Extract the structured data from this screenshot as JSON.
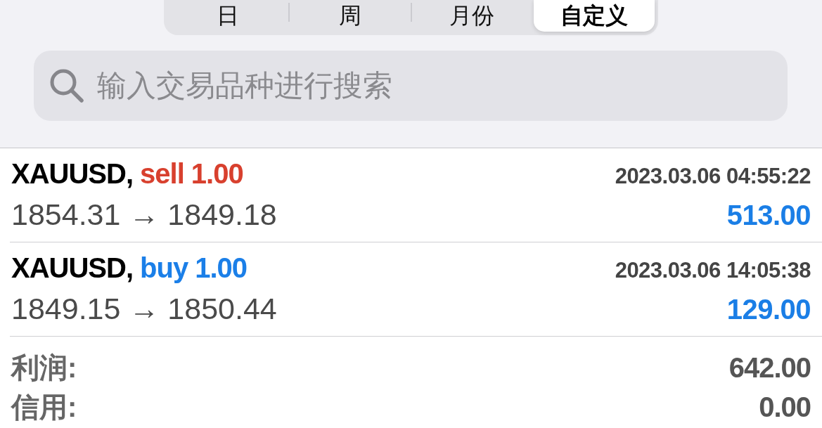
{
  "segments": [
    {
      "label": "日",
      "selected": false
    },
    {
      "label": "周",
      "selected": false
    },
    {
      "label": "月份",
      "selected": false
    },
    {
      "label": "自定义",
      "selected": true
    }
  ],
  "search": {
    "placeholder": "输入交易品种进行搜索"
  },
  "trades": [
    {
      "symbol": "XAUUSD,",
      "kind": "sell",
      "order": "sell 1.00",
      "time": "2023.03.06 04:55:22",
      "prices": "1854.31 → 1849.18",
      "profit": "513.00"
    },
    {
      "symbol": "XAUUSD,",
      "kind": "buy",
      "order": "buy 1.00",
      "time": "2023.03.06 14:05:38",
      "prices": "1849.15 → 1850.44",
      "profit": "129.00"
    }
  ],
  "summary": [
    {
      "label": "利润:",
      "value": "642.00"
    },
    {
      "label": "信用:",
      "value": "0.00"
    }
  ]
}
